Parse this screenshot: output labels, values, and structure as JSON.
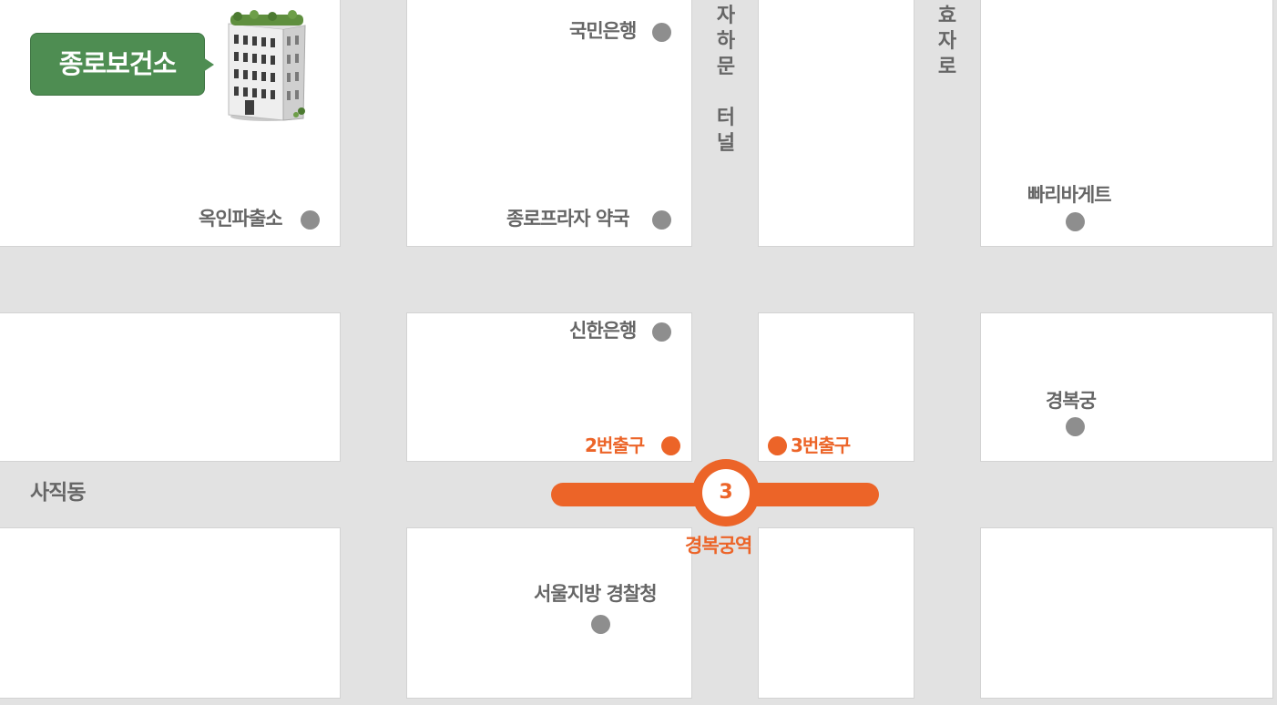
{
  "building": {
    "name": "종로보건소",
    "icon": "building-icon"
  },
  "places": {
    "kookmin_bank": "국민은행",
    "okin_police": "옥인파출소",
    "jongno_plaza_pharmacy": "종로프라자 약국",
    "paris_baguette": "빠리바게트",
    "shinhan_bank": "신한은행",
    "gyeongbokgung": "경복궁",
    "seoul_police": "서울지방 경찰청"
  },
  "areas": {
    "sajik": "사직동"
  },
  "roads": {
    "jahamun": "자\n하\n문\n\n터\n널",
    "hyoja": "효\n자\n로"
  },
  "station": {
    "line_number": "3",
    "name": "경복궁역",
    "exit2": "2번출구",
    "exit3": "3번출구",
    "line_color": "#ec6428"
  },
  "colors": {
    "road": "#e2e2e2",
    "block": "#ffffff",
    "poi_dot": "#8e8e8e",
    "callout": "#4e8d52",
    "text": "#666666"
  }
}
